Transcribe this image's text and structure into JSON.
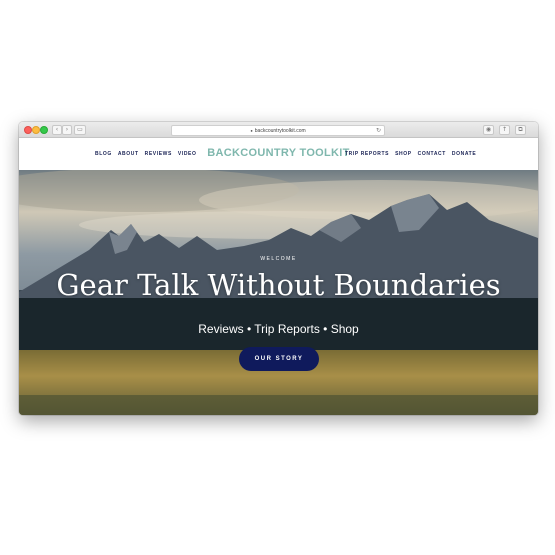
{
  "browser": {
    "url": "backcountrytoolkit.com",
    "lock_icon": "lock-icon",
    "reload_icon": "reload-icon"
  },
  "site": {
    "logo": "BACKCOUNTRY TOOLKIT",
    "nav_left": [
      "BLOG",
      "ABOUT",
      "REVIEWS",
      "VIDEO"
    ],
    "nav_right": [
      "TRIP REPORTS",
      "SHOP",
      "CONTACT",
      "DONATE"
    ]
  },
  "hero": {
    "eyebrow": "WELCOME",
    "headline": "Gear Talk Without Boundaries",
    "subline": "Reviews • Trip Reports • Shop",
    "cta_label": "OUR STORY"
  },
  "colors": {
    "logo": "#7fb7ad",
    "nav": "#1a2355",
    "cta_bg": "#0f1a5c"
  }
}
